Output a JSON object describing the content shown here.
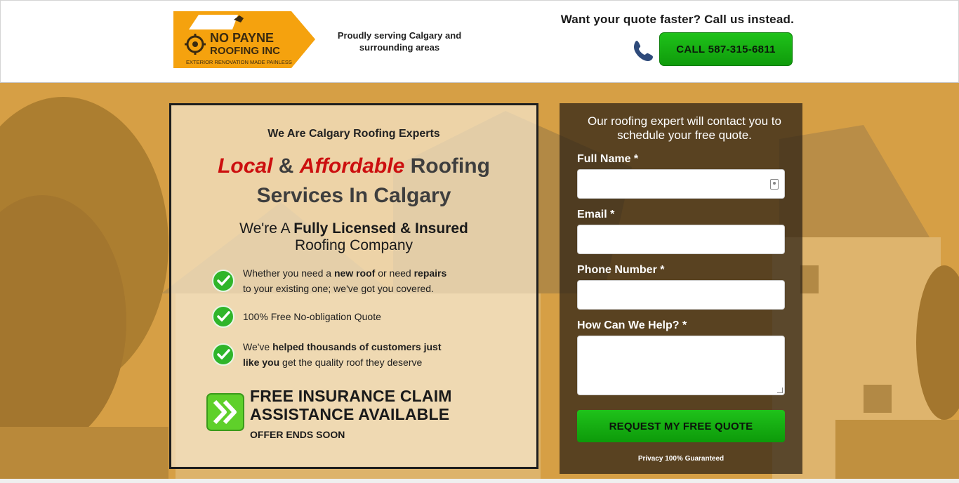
{
  "header": {
    "logo": {
      "name_line1": "NO PAYNE",
      "name_line2": "ROOFING INC",
      "tagline": "EXTERIOR RENOVATION MADE PAINLESS"
    },
    "service_area": "Proudly serving Calgary and surrounding areas",
    "call_prompt": "Want your quote faster? Call us instead.",
    "call_button": "CALL 587-315-6811"
  },
  "hero_card": {
    "eyebrow": "We Are Calgary Roofing Experts",
    "headline_local": "Local",
    "headline_amp": " & ",
    "headline_affordable": "Affordable",
    "headline_rest1": " Roofing",
    "headline_rest2": "Services In Calgary",
    "sub_prefix": "We're A ",
    "sub_bold": "Fully Licensed & Insured",
    "sub_line2": "Roofing Company",
    "bullets": [
      {
        "t1": "Whether you need a ",
        "b1": "new roof",
        "t2": " or need ",
        "b2": "repairs",
        "t3": "to your existing one; we've got you covered."
      },
      {
        "t1": "100% Free No-obligation Quote"
      },
      {
        "t1": "We've ",
        "b1": "helped thousands of customers just",
        "b2": "like you",
        "t2": " get the quality roof they deserve"
      }
    ],
    "promo_title_line1": "FREE INSURANCE CLAIM",
    "promo_title_line2": "ASSISTANCE AVAILABLE",
    "promo_note": "OFFER ENDS SOON"
  },
  "form": {
    "intro": "Our roofing expert will contact you to schedule your free quote.",
    "fields": {
      "full_name": "Full Name *",
      "email": "Email *",
      "phone": "Phone Number *",
      "help": "How Can We Help? *"
    },
    "submit": "REQUEST MY FREE QUOTE",
    "privacy": "Privacy 100% Guaranteed"
  },
  "colors": {
    "accent_green": "#13ad10",
    "headline_red": "#cc0f0f",
    "logo_orange": "#f5a20e"
  }
}
